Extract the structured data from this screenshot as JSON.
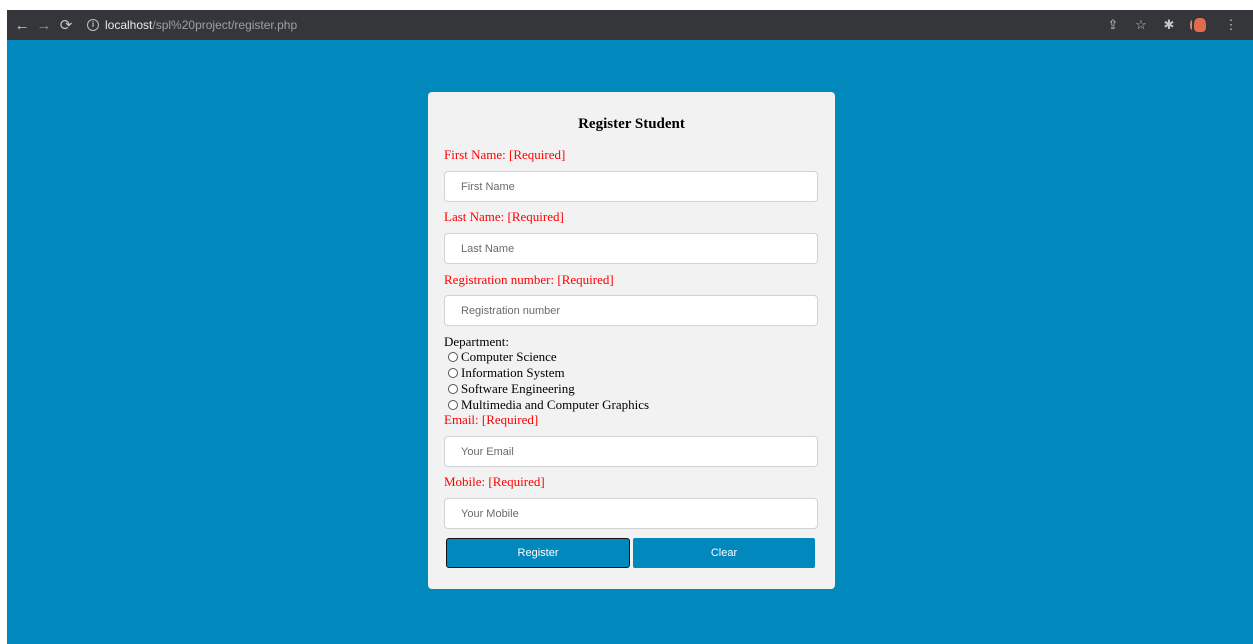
{
  "browser": {
    "url_host": "localhost",
    "url_path": "/spl%20project/register.php"
  },
  "form": {
    "title": "Register Student",
    "first_name_label": "First Name: [Required]",
    "first_name_placeholder": "First Name",
    "last_name_label": "Last Name: [Required]",
    "last_name_placeholder": "Last Name",
    "reg_label": "Registration number: [Required]",
    "reg_placeholder": "Registration number",
    "department_label": "Department:",
    "departments": [
      "Computer Science",
      "Information System",
      "Software Engineering",
      "Multimedia and Computer Graphics"
    ],
    "email_label": "Email: [Required]",
    "email_placeholder": "Your Email",
    "mobile_label": "Mobile: [Required]",
    "mobile_placeholder": "Your Mobile",
    "register_label": "Register",
    "clear_label": "Clear"
  },
  "colors": {
    "page_bg": "#0188bc",
    "card_bg": "#f2f2f2",
    "required_label": "#ff0000",
    "button_bg": "#0188bc"
  }
}
